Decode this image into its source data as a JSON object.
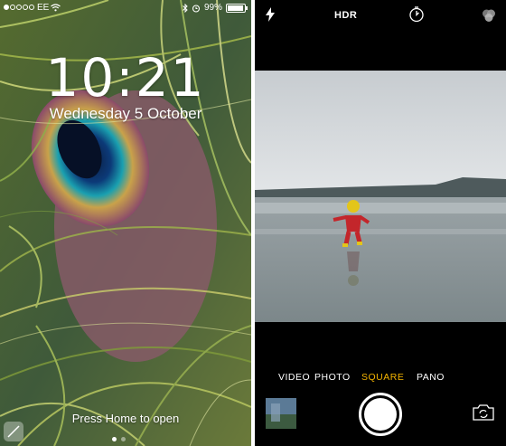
{
  "lock_screen": {
    "status": {
      "carrier": "EE",
      "battery": "99%"
    },
    "time": "10:21",
    "date": "Wednesday 5 October",
    "unlock_hint": "Press Home to open",
    "page_count": 2,
    "active_page": 1
  },
  "camera": {
    "top_bar": {
      "hdr": "HDR"
    },
    "modes": [
      "VIDEO",
      "PHOTO",
      "SQUARE",
      "PANO"
    ],
    "active_mode": "SQUARE",
    "colors": {
      "active_mode": "#f4b400",
      "background": "#000000"
    }
  },
  "icons": [
    "signal-dots-icon",
    "wifi-icon",
    "bluetooth-icon",
    "battery-icon",
    "flash-icon",
    "timer-icon",
    "filters-icon",
    "shutter-button",
    "camera-flip-icon",
    "camera-shortcut-icon"
  ]
}
